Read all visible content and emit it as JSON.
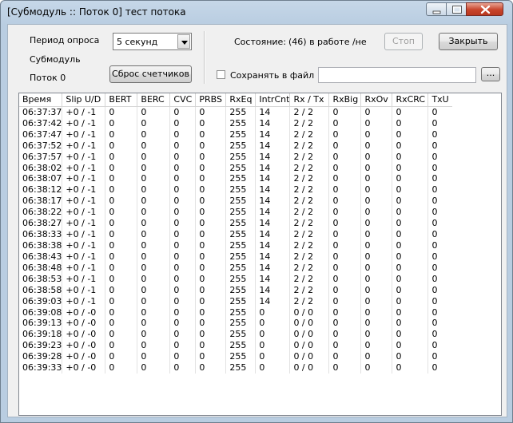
{
  "window": {
    "title": "[Субмодуль :: Поток 0]  тест потока"
  },
  "controls": {
    "poll_period_label": "Период опроса",
    "poll_period_value": "5 секунд",
    "submodule_label": "Субмодуль",
    "stream_label": "Поток 0",
    "reset_counters_button": "Сброс счетчиков",
    "state_label": "Состояние:",
    "state_value": "(46) в работе /не",
    "stop_button": "Стоп",
    "close_button": "Закрыть",
    "save_to_file_label": "Сохранять в файл",
    "save_to_file_checked": false,
    "file_path_value": "",
    "browse_button": "..."
  },
  "table": {
    "columns": [
      "Время",
      "Slip U/D",
      "BERT",
      "BERC",
      "CVC",
      "PRBS",
      "RxEq",
      "IntrCnt",
      "Rx / Tx",
      "RxBig",
      "RxOv",
      "RxCRC",
      "TxU"
    ],
    "rows": [
      [
        "06:37:37",
        "+0 / -1",
        "0",
        "0",
        "0",
        "0",
        "255",
        "14",
        "2 / 2",
        "0",
        "0",
        "0",
        "0"
      ],
      [
        "06:37:42",
        "+0 / -1",
        "0",
        "0",
        "0",
        "0",
        "255",
        "14",
        "2 / 2",
        "0",
        "0",
        "0",
        "0"
      ],
      [
        "06:37:47",
        "+0 / -1",
        "0",
        "0",
        "0",
        "0",
        "255",
        "14",
        "2 / 2",
        "0",
        "0",
        "0",
        "0"
      ],
      [
        "06:37:52",
        "+0 / -1",
        "0",
        "0",
        "0",
        "0",
        "255",
        "14",
        "2 / 2",
        "0",
        "0",
        "0",
        "0"
      ],
      [
        "06:37:57",
        "+0 / -1",
        "0",
        "0",
        "0",
        "0",
        "255",
        "14",
        "2 / 2",
        "0",
        "0",
        "0",
        "0"
      ],
      [
        "06:38:02",
        "+0 / -1",
        "0",
        "0",
        "0",
        "0",
        "255",
        "14",
        "2 / 2",
        "0",
        "0",
        "0",
        "0"
      ],
      [
        "06:38:07",
        "+0 / -1",
        "0",
        "0",
        "0",
        "0",
        "255",
        "14",
        "2 / 2",
        "0",
        "0",
        "0",
        "0"
      ],
      [
        "06:38:12",
        "+0 / -1",
        "0",
        "0",
        "0",
        "0",
        "255",
        "14",
        "2 / 2",
        "0",
        "0",
        "0",
        "0"
      ],
      [
        "06:38:17",
        "+0 / -1",
        "0",
        "0",
        "0",
        "0",
        "255",
        "14",
        "2 / 2",
        "0",
        "0",
        "0",
        "0"
      ],
      [
        "06:38:22",
        "+0 / -1",
        "0",
        "0",
        "0",
        "0",
        "255",
        "14",
        "2 / 2",
        "0",
        "0",
        "0",
        "0"
      ],
      [
        "06:38:27",
        "+0 / -1",
        "0",
        "0",
        "0",
        "0",
        "255",
        "14",
        "2 / 2",
        "0",
        "0",
        "0",
        "0"
      ],
      [
        "06:38:33",
        "+0 / -1",
        "0",
        "0",
        "0",
        "0",
        "255",
        "14",
        "2 / 2",
        "0",
        "0",
        "0",
        "0"
      ],
      [
        "06:38:38",
        "+0 / -1",
        "0",
        "0",
        "0",
        "0",
        "255",
        "14",
        "2 / 2",
        "0",
        "0",
        "0",
        "0"
      ],
      [
        "06:38:43",
        "+0 / -1",
        "0",
        "0",
        "0",
        "0",
        "255",
        "14",
        "2 / 2",
        "0",
        "0",
        "0",
        "0"
      ],
      [
        "06:38:48",
        "+0 / -1",
        "0",
        "0",
        "0",
        "0",
        "255",
        "14",
        "2 / 2",
        "0",
        "0",
        "0",
        "0"
      ],
      [
        "06:38:53",
        "+0 / -1",
        "0",
        "0",
        "0",
        "0",
        "255",
        "14",
        "2 / 2",
        "0",
        "0",
        "0",
        "0"
      ],
      [
        "06:38:58",
        "+0 / -1",
        "0",
        "0",
        "0",
        "0",
        "255",
        "14",
        "2 / 2",
        "0",
        "0",
        "0",
        "0"
      ],
      [
        "06:39:03",
        "+0 / -1",
        "0",
        "0",
        "0",
        "0",
        "255",
        "14",
        "2 / 2",
        "0",
        "0",
        "0",
        "0"
      ],
      [
        "06:39:08",
        "+0 / -0",
        "0",
        "0",
        "0",
        "0",
        "255",
        "0",
        "0 / 0",
        "0",
        "0",
        "0",
        "0"
      ],
      [
        "06:39:13",
        "+0 / -0",
        "0",
        "0",
        "0",
        "0",
        "255",
        "0",
        "0 / 0",
        "0",
        "0",
        "0",
        "0"
      ],
      [
        "06:39:18",
        "+0 / -0",
        "0",
        "0",
        "0",
        "0",
        "255",
        "0",
        "0 / 0",
        "0",
        "0",
        "0",
        "0"
      ],
      [
        "06:39:23",
        "+0 / -0",
        "0",
        "0",
        "0",
        "0",
        "255",
        "0",
        "0 / 0",
        "0",
        "0",
        "0",
        "0"
      ],
      [
        "06:39:28",
        "+0 / -0",
        "0",
        "0",
        "0",
        "0",
        "255",
        "0",
        "0 / 0",
        "0",
        "0",
        "0",
        "0"
      ],
      [
        "06:39:33",
        "+0 / -0",
        "0",
        "0",
        "0",
        "0",
        "255",
        "0",
        "0 / 0",
        "0",
        "0",
        "0",
        "0"
      ]
    ]
  }
}
